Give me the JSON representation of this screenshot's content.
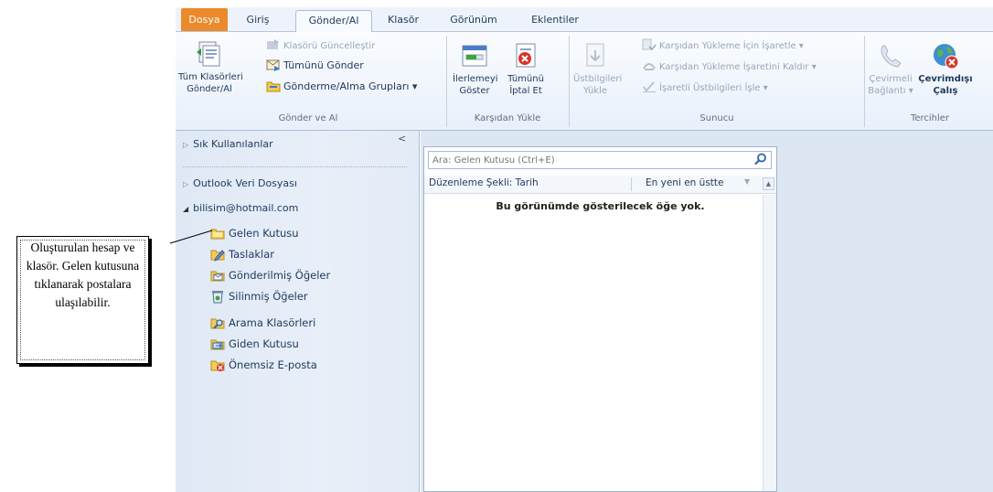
{
  "tabs": [
    {
      "label": "Dosya",
      "type": "file"
    },
    {
      "label": "Giriş",
      "type": "normal"
    },
    {
      "label": "Gönder/Al",
      "type": "active"
    },
    {
      "label": "Klasör",
      "type": "normal"
    },
    {
      "label": "Görünüm",
      "type": "normal"
    },
    {
      "label": "Eklentiler",
      "type": "normal"
    }
  ],
  "ribbon": {
    "group_send_receive": {
      "label": "Gönder ve Al",
      "send_all_line1": "Tüm Klasörleri",
      "send_all_line2": "Gönder/Al",
      "update_folder": "Klasörü Güncelleştir",
      "send_all": "Tümünü Gönder",
      "send_receive_groups": "Gönderme/Alma Grupları ▾"
    },
    "group_download": {
      "label": "Karşıdan Yükle",
      "show_progress_line1": "İlerlemeyi",
      "show_progress_line2": "Göster",
      "cancel_all_line1": "Tümünü",
      "cancel_all_line2": "İptal Et"
    },
    "group_server": {
      "label": "Sunucu",
      "download_headers_line1": "Üstbilgileri",
      "download_headers_line2": "Yükle",
      "mark_download": "Karşıdan Yükleme İçin İşaretle ▾",
      "unmark_download": "Karşıdan Yükleme İşaretini Kaldır ▾",
      "process_marked": "İşaretli Üstbilgileri İşle ▾"
    },
    "group_preferences": {
      "label": "Tercihler",
      "dialup_line1": "Çevirmeli",
      "dialup_line2": "Bağlantı ▾",
      "offline_line1": "Çevrimdışı",
      "offline_line2": "Çalış"
    }
  },
  "nav": {
    "favorites": "Sık Kullanılanlar",
    "collapse": "<",
    "data_file": "Outlook Veri Dosyası",
    "account": "bilisim@hotmail.com",
    "folders": [
      {
        "label": "Gelen Kutusu",
        "icon": "inbox-folder-icon"
      },
      {
        "label": "Taslaklar",
        "icon": "drafts-icon"
      },
      {
        "label": "Gönderilmiş Öğeler",
        "icon": "sent-items-icon"
      },
      {
        "label": "Silinmiş Öğeler",
        "icon": "deleted-items-icon"
      },
      {
        "label": "Arama Klasörleri",
        "icon": "search-folders-icon"
      },
      {
        "label": "Giden Kutusu",
        "icon": "outbox-icon"
      },
      {
        "label": "Önemsiz E-posta",
        "icon": "junk-email-icon"
      }
    ]
  },
  "list": {
    "search_placeholder": "Ara: Gelen Kutusu (Ctrl+E)",
    "sort_label": "Düzenleme Şekli: Tarih",
    "order_label": "En yeni en üstte",
    "empty_message": "Bu görünümde gösterilecek öğe yok."
  },
  "annotation": {
    "text": "Oluşturulan hesap ve klasör. Gelen kutusuna tıklanarak postalara ulaşılabilir."
  },
  "colors": {
    "file_tab": "#ea8a2b",
    "ribbon_text": "#1e395b",
    "nav_bg": "#dfe8f5"
  }
}
